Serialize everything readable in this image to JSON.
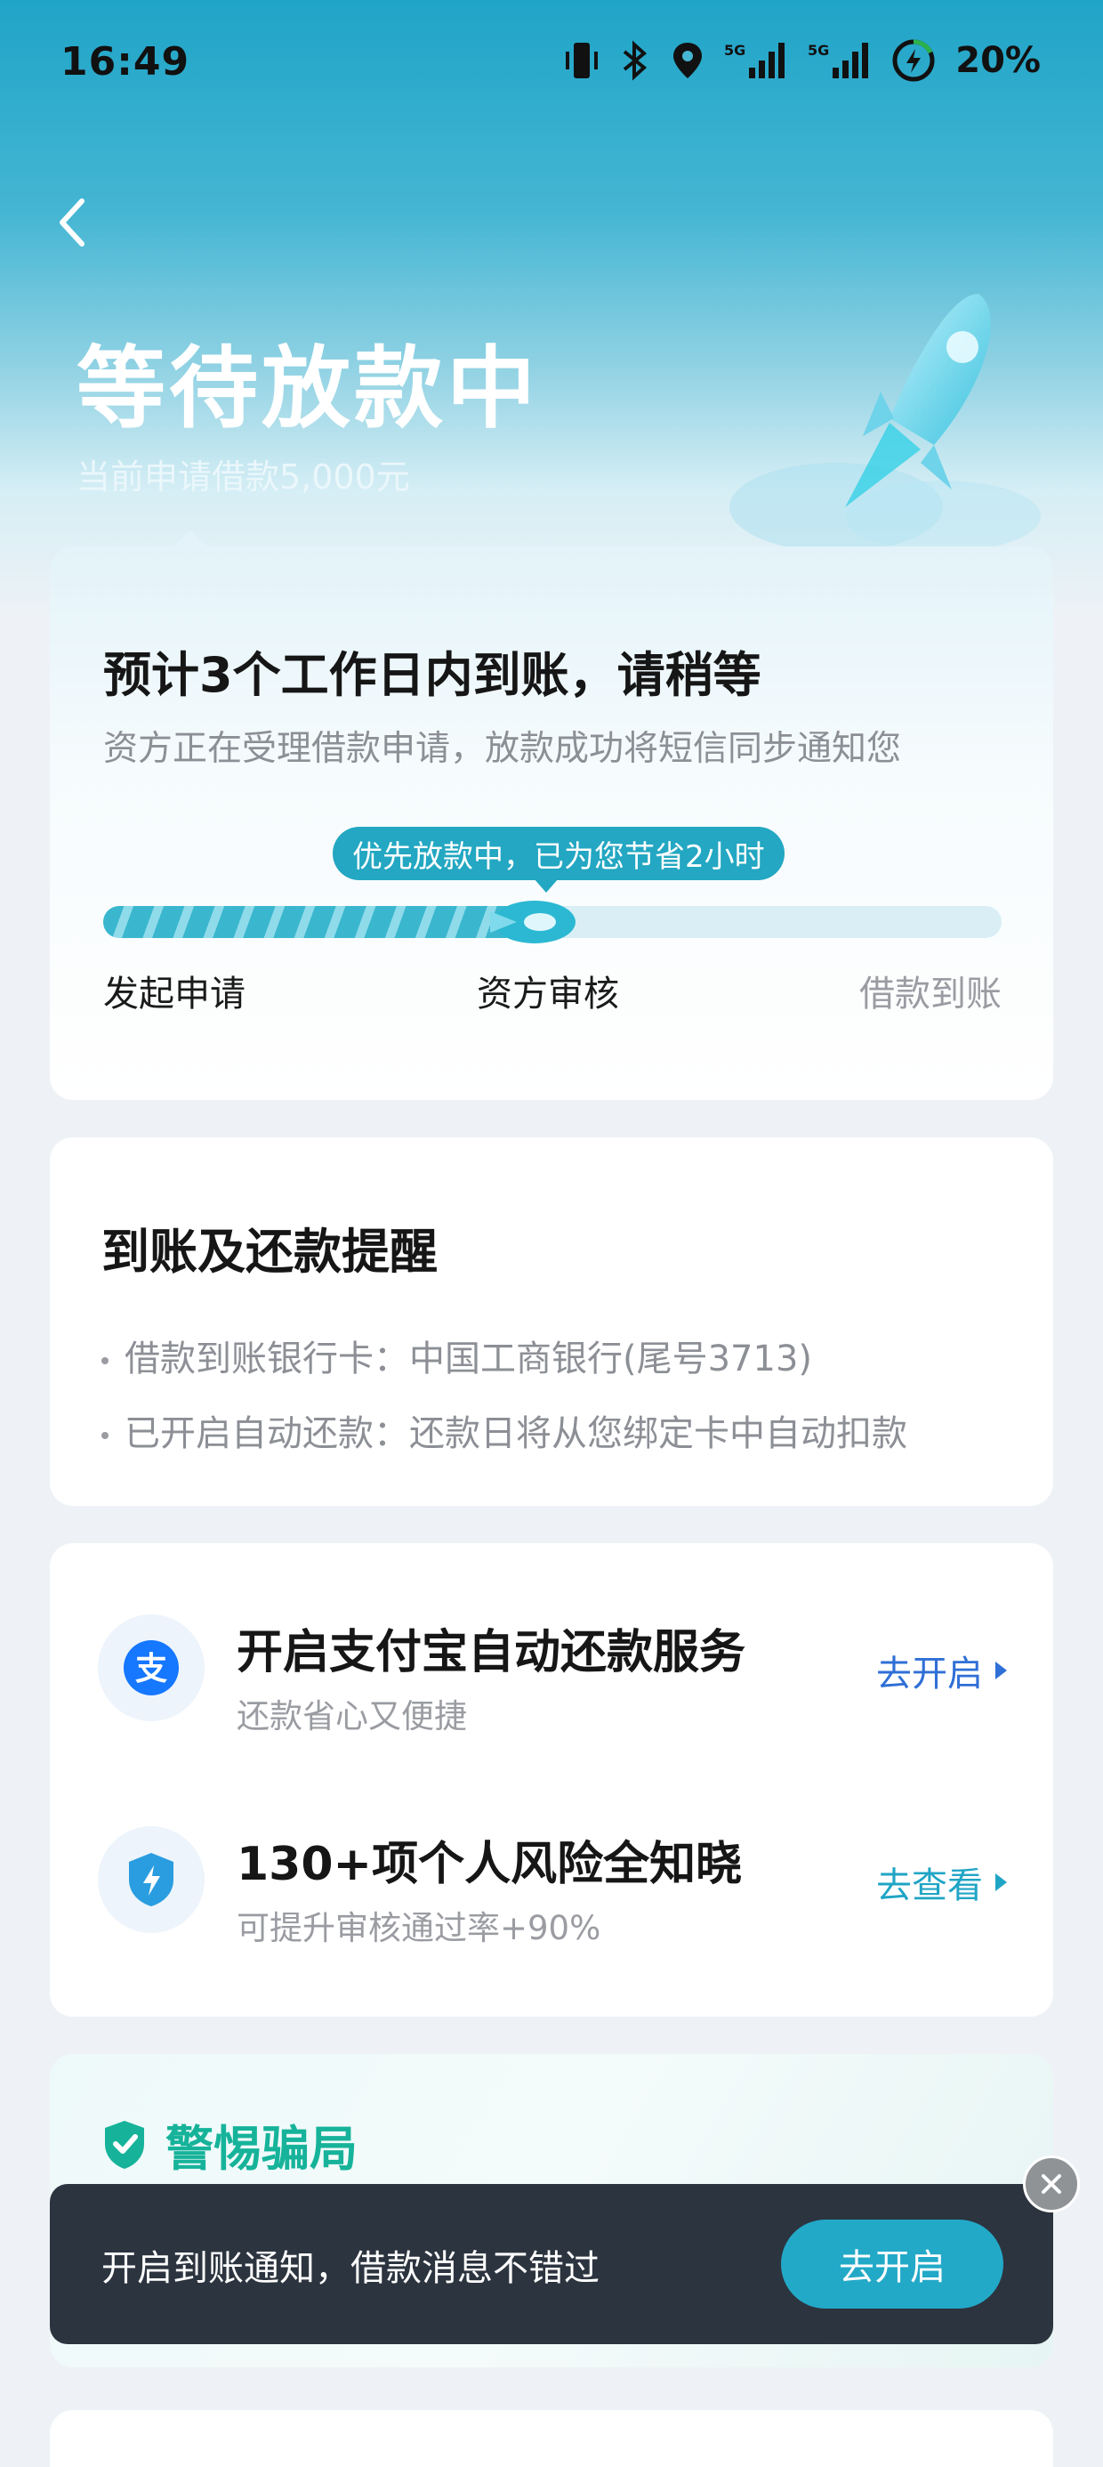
{
  "status_bar": {
    "time": "16:49",
    "battery": "20%",
    "icons": [
      "vibrate-icon",
      "bluetooth-icon",
      "location-icon",
      "signal-5g-icon",
      "signal-5g-icon",
      "battery-charging-icon"
    ]
  },
  "header": {
    "back_icon": "chevron-left-icon",
    "title": "等待放款中",
    "subtitle": "当前申请借款5,000元"
  },
  "status_card": {
    "title": "预计3个工作日内到账，请稍等",
    "description": "资方正在受理借款申请，放款成功将短信同步通知您",
    "progress_tip": "优先放款中，已为您节省2小时",
    "progress_fraction": 0.52,
    "steps": [
      "发起申请",
      "资方审核",
      "借款到账"
    ]
  },
  "remind_card": {
    "title": "到账及还款提醒",
    "lines": [
      "借款到账银行卡：中国工商银行(尾号3713)",
      "已开启自动还款：还款日将从您绑定卡中自动扣款"
    ]
  },
  "services": [
    {
      "icon": "alipay-icon",
      "title": "开启支付宝自动还款服务",
      "subtitle": "还款省心又便捷",
      "action": "去开启"
    },
    {
      "icon": "shield-bolt-icon",
      "title": "130+项个人风险全知晓",
      "subtitle": "可提升审核通过率+90%",
      "action": "去查看"
    }
  ],
  "fraud_card": {
    "icon": "shield-check-icon",
    "title": "警惕骗局"
  },
  "toast": {
    "text": "开启到账通知，借款消息不错过",
    "button": "去开启",
    "close_icon": "close-icon"
  },
  "colors": {
    "brand": "#23a9c8",
    "link_blue": "#2f6fd6",
    "fraud_green": "#16b39a",
    "toast_bg": "#2c343f"
  }
}
